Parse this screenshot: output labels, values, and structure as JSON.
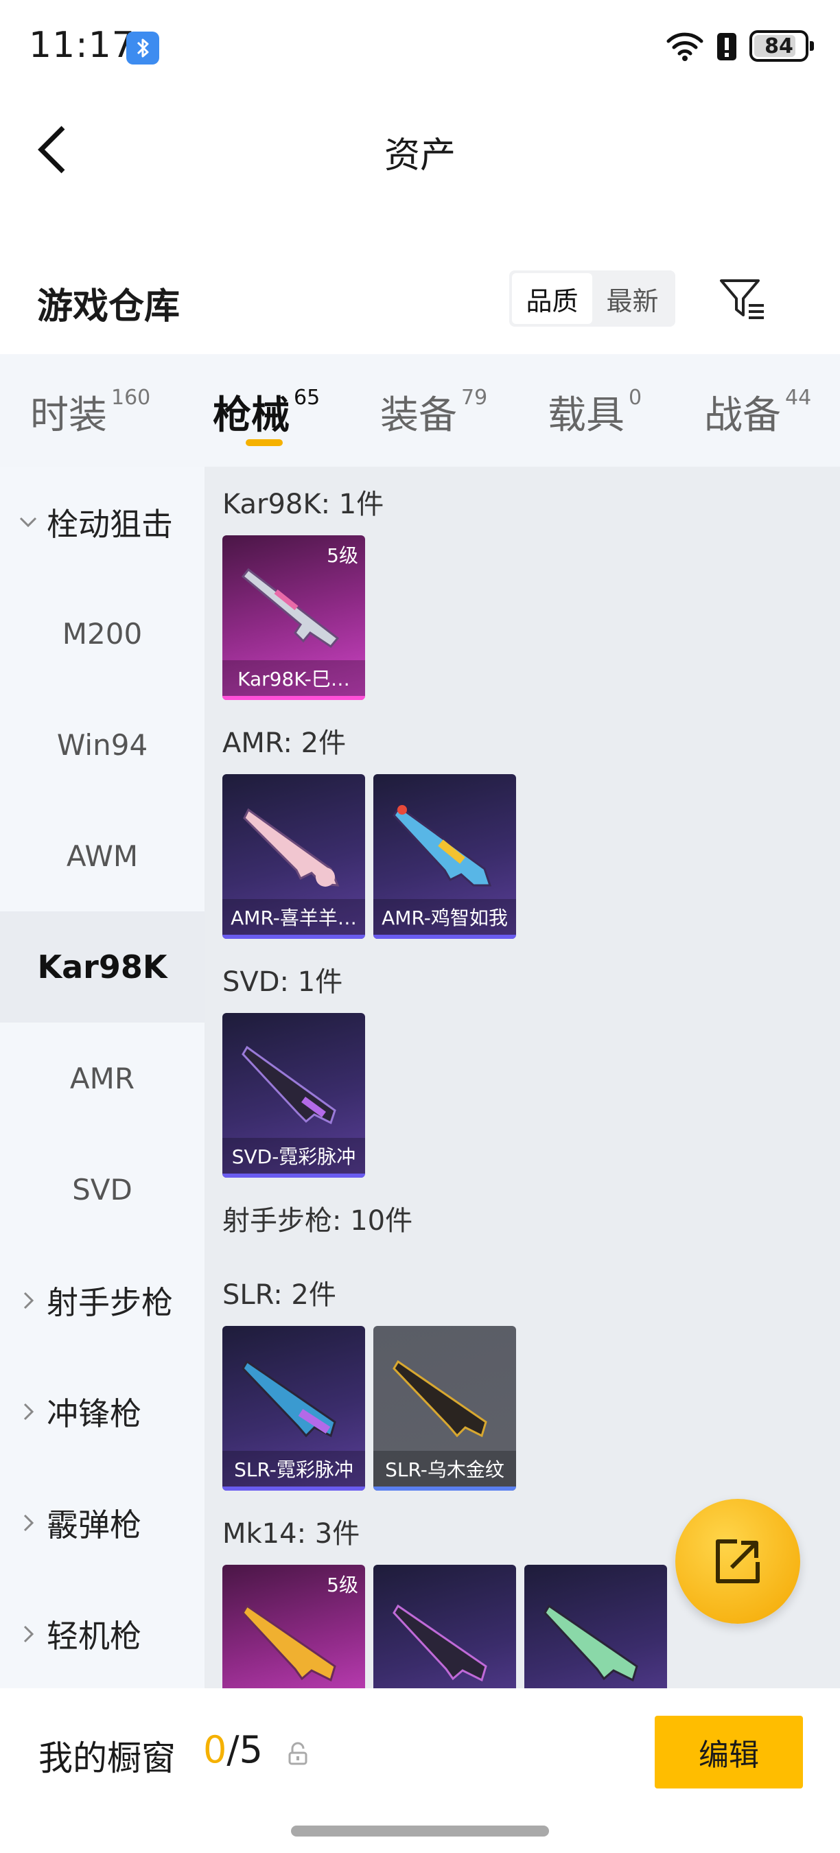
{
  "status_bar": {
    "time": "11:17",
    "battery": "84",
    "battery_level": 0.84
  },
  "nav": {
    "title": "资产"
  },
  "warehouse": {
    "title": "游戏仓库",
    "sort_options": [
      "品质",
      "最新"
    ],
    "sort_selected": "品质"
  },
  "tabs": [
    {
      "label": "时装",
      "count": "160"
    },
    {
      "label": "枪械",
      "count": "65",
      "active": true
    },
    {
      "label": "装备",
      "count": "79"
    },
    {
      "label": "载具",
      "count": "0"
    },
    {
      "label": "战备",
      "count": "44"
    }
  ],
  "sidebar": {
    "items": [
      {
        "label": "栓动狙击",
        "type": "group",
        "expanded": true
      },
      {
        "label": "M200"
      },
      {
        "label": "Win94"
      },
      {
        "label": "AWM"
      },
      {
        "label": "Kar98K",
        "active": true
      },
      {
        "label": "AMR"
      },
      {
        "label": "SVD"
      },
      {
        "label": "射手步枪",
        "type": "group",
        "expanded": false
      },
      {
        "label": "冲锋枪",
        "type": "group",
        "expanded": false
      },
      {
        "label": "霰弹枪",
        "type": "group",
        "expanded": false
      },
      {
        "label": "轻机枪",
        "type": "group",
        "expanded": false
      }
    ]
  },
  "content": {
    "groups": [
      {
        "title": "Kar98K: 1件",
        "items": [
          {
            "name": "Kar98K-巳…",
            "level": "5级",
            "rarity": "pink"
          }
        ]
      },
      {
        "title": "AMR: 2件",
        "items": [
          {
            "name": "AMR-喜羊羊…",
            "rarity": "purple"
          },
          {
            "name": "AMR-鸡智如我",
            "rarity": "purple"
          }
        ]
      },
      {
        "title": "SVD: 1件",
        "items": [
          {
            "name": "SVD-霓彩脉冲",
            "rarity": "purple"
          }
        ]
      },
      {
        "title": "射手步枪: 10件",
        "items": []
      },
      {
        "title": "SLR: 2件",
        "items": [
          {
            "name": "SLR-霓彩脉冲",
            "rarity": "purple"
          },
          {
            "name": "SLR-乌木金纹",
            "rarity": "grey"
          }
        ]
      },
      {
        "title": "Mk14: 3件",
        "items": [
          {
            "name": "",
            "level": "5级",
            "rarity": "pink"
          },
          {
            "name": "",
            "rarity": "purple"
          },
          {
            "name": "",
            "rarity": "purple"
          }
        ]
      }
    ]
  },
  "showcase": {
    "title": "我的橱窗",
    "used": "0",
    "separator": "/",
    "total": "5",
    "edit_label": "编辑"
  },
  "colors": {
    "accent": "#ffbd00",
    "rarity_pink": "#d045c8",
    "rarity_purple": "#5b3f9a",
    "rarity_grey": "#5f6169"
  },
  "icons": [
    "bluetooth-icon",
    "wifi-icon",
    "battery-saver-icon",
    "back-arrow-icon",
    "filter-icon",
    "chevron-down-icon",
    "chevron-right-icon",
    "share-icon",
    "lock-icon"
  ]
}
